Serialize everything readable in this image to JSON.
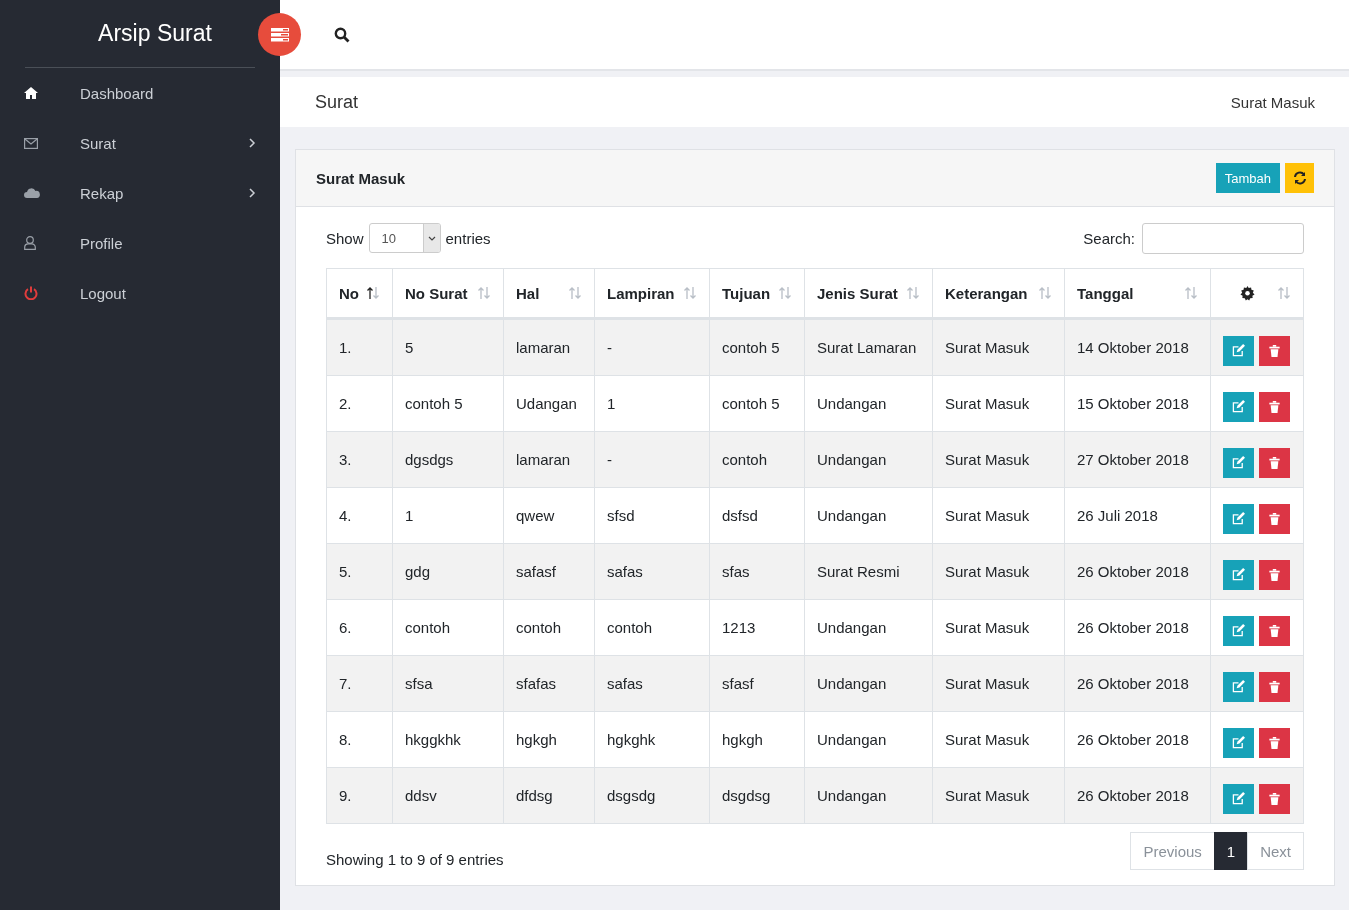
{
  "sidebar": {
    "title": "Arsip Surat",
    "items": [
      {
        "label": "Dashboard",
        "has_submenu": false
      },
      {
        "label": "Surat",
        "has_submenu": true
      },
      {
        "label": "Rekap",
        "has_submenu": true
      },
      {
        "label": "Profile",
        "has_submenu": false
      },
      {
        "label": "Logout",
        "has_submenu": false
      }
    ]
  },
  "breadcrumb": {
    "title": "Surat",
    "current": "Surat Masuk"
  },
  "card": {
    "title": "Surat Masuk",
    "add_button": "Tambah",
    "length": {
      "label_before": "Show",
      "value": "10",
      "label_after": "entries"
    },
    "search": {
      "label": "Search:"
    },
    "table": {
      "columns": [
        {
          "label": "No",
          "sorted": true
        },
        {
          "label": "No Surat",
          "sorted": false
        },
        {
          "label": "Hal",
          "sorted": false
        },
        {
          "label": "Lampiran",
          "sorted": false
        },
        {
          "label": "Tujuan",
          "sorted": false
        },
        {
          "label": "Jenis Surat",
          "sorted": false
        },
        {
          "label": "Keterangan",
          "sorted": false
        },
        {
          "label": "Tanggal",
          "sorted": false
        },
        {
          "kind": "gear",
          "sorted": false
        }
      ],
      "rows": [
        [
          "1.",
          "5",
          "lamaran",
          "-",
          "contoh 5",
          "Surat Lamaran",
          "Surat Masuk",
          "14 Oktober 2018"
        ],
        [
          "2.",
          "contoh 5",
          "Udangan",
          "1",
          "contoh 5",
          "Undangan",
          "Surat Masuk",
          "15 Oktober 2018"
        ],
        [
          "3.",
          "dgsdgs",
          "lamaran",
          "-",
          "contoh",
          "Undangan",
          "Surat Masuk",
          "27 Oktober 2018"
        ],
        [
          "4.",
          "1",
          "qwew",
          "sfsd",
          "dsfsd",
          "Undangan",
          "Surat Masuk",
          "26 Juli 2018"
        ],
        [
          "5.",
          "gdg",
          "safasf",
          "safas",
          "sfas",
          "Surat Resmi",
          "Surat Masuk",
          "26 Oktober 2018"
        ],
        [
          "6.",
          "contoh",
          "contoh",
          "contoh",
          "1213",
          "Undangan",
          "Surat Masuk",
          "26 Oktober 2018"
        ],
        [
          "7.",
          "sfsa",
          "sfafas",
          "safas",
          "sfasf",
          "Undangan",
          "Surat Masuk",
          "26 Oktober 2018"
        ],
        [
          "8.",
          "hkggkhk",
          "hgkgh",
          "hgkghk",
          "hgkgh",
          "Undangan",
          "Surat Masuk",
          "26 Oktober 2018"
        ],
        [
          "9.",
          "ddsv",
          "dfdsg",
          "dsgsdg",
          "dsgdsg",
          "Undangan",
          "Surat Masuk",
          "26 Oktober 2018"
        ]
      ]
    },
    "info": "Showing 1 to 9 of 9 entries",
    "pagination": [
      {
        "label": "Previous",
        "selected": false,
        "disabled": true
      },
      {
        "label": "1",
        "selected": true,
        "disabled": false
      },
      {
        "label": "Next",
        "selected": false,
        "disabled": true
      }
    ]
  }
}
